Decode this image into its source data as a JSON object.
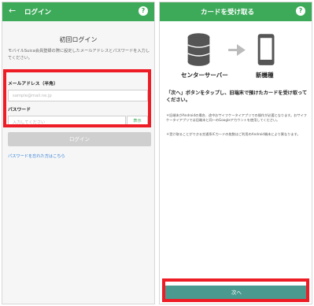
{
  "left": {
    "title": "ログイン",
    "back_icon": "arrow-left-icon",
    "help_icon": "help-icon",
    "help_glyph": "?",
    "heading": "初回ログイン",
    "description": "モバイルSuica会員登録の際に設定したメールアドレスとパスワードを入力してください。",
    "email_label": "メールアドレス（半角）",
    "email_placeholder": "sample@mail.ne.jp",
    "password_label": "パスワード",
    "password_placeholder": "入力してください",
    "show_label": "表示",
    "login_label": "ログイン",
    "forgot_label": "パスワードを忘れた方はこちら"
  },
  "right": {
    "title": "カードを受け取る",
    "help_icon": "help-icon",
    "help_glyph": "?",
    "server_label": "センターサーバー",
    "device_label": "新機種",
    "instruction": "「次へ」ボタンをタップし、旧端末で預けたカードを受け取ってください。",
    "note1": "＊旧端末がAndroidの場合、途中おサイフケータイアプリでの操作が必要となります。おサイフケータイアプリでは旧端末と同一のGoogleアカウントを使用してください。",
    "note2": "＊受け取ることができる交通系ICカードの枚数はご利用のAndroid端末により異なります。",
    "next_label": "次へ"
  },
  "colors": {
    "header_green": "#3daa5a",
    "highlight_red": "#ee1c25",
    "next_teal": "#4a9a8f",
    "disabled_gray": "#cfcfcf",
    "link_blue": "#2f7ed8"
  }
}
